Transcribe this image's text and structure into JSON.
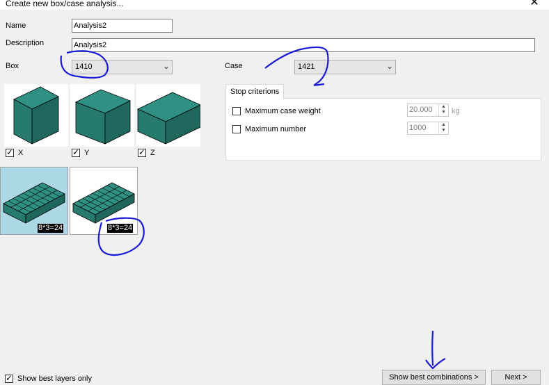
{
  "window": {
    "title": "Create new box/case analysis...",
    "close_glyph": "✕"
  },
  "form": {
    "name_label": "Name",
    "name_value": "Analysis2",
    "description_label": "Description",
    "description_value": "Analysis2",
    "box_label": "Box",
    "box_value": "1410",
    "case_label": "Case",
    "case_value": "1421"
  },
  "orientations": [
    {
      "label": "X",
      "checked": true
    },
    {
      "label": "Y",
      "checked": true
    },
    {
      "label": "Z",
      "checked": true
    }
  ],
  "stop_criterions": {
    "tab_label": "Stop criterions",
    "max_weight_label": "Maximum case weight",
    "max_weight_value": "20.000",
    "max_weight_unit": "kg",
    "max_number_label": "Maximum number",
    "max_number_value": "1000"
  },
  "layers": [
    {
      "caption": "8*3=24",
      "selected": true
    },
    {
      "caption": "8*3=24",
      "selected": false
    }
  ],
  "footer": {
    "show_best_layers_label": "Show best layers only",
    "show_best_layers_checked": true,
    "show_best_button": "Show best combinations >",
    "next_button": "Next >"
  },
  "colors": {
    "box_face_front": "#267a6e",
    "box_face_top": "#2f9184",
    "box_face_side": "#1f665c",
    "selected_layer_bg": "#add8e6",
    "annotation": "#1a1ad6"
  },
  "icons": {
    "dropdown_arrow": "⌄",
    "spin_up": "▲",
    "spin_down": "▼"
  }
}
